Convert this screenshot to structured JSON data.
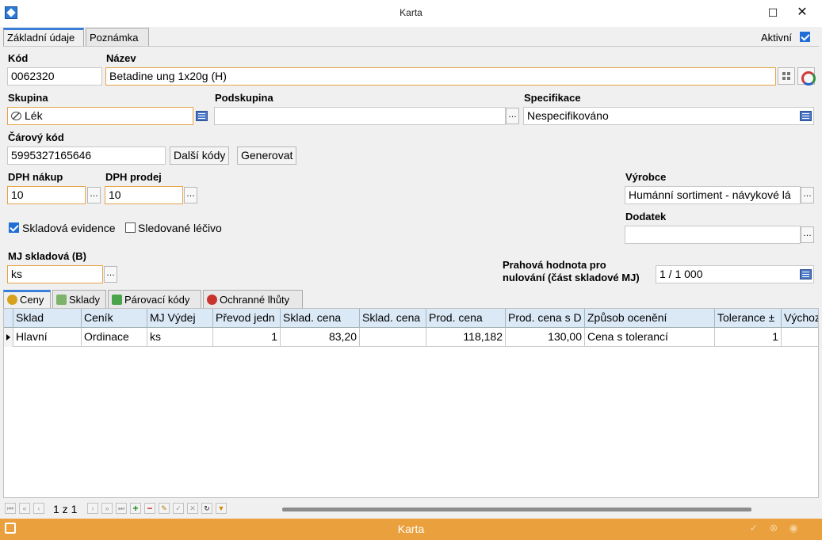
{
  "window": {
    "title": "Karta"
  },
  "tabs_top": [
    {
      "label": "Základní údaje",
      "active": true
    },
    {
      "label": "Poznámka",
      "active": false
    }
  ],
  "aktivni": {
    "label": "Aktivní",
    "checked": true
  },
  "fields": {
    "kod": {
      "label": "Kód",
      "value": "0062320"
    },
    "nazev": {
      "label": "Název",
      "value": "Betadine ung 1x20g (H)"
    },
    "skupina": {
      "label": "Skupina",
      "value": "Lék"
    },
    "podskupina": {
      "label": "Podskupina",
      "value": ""
    },
    "specifikace": {
      "label": "Specifikace",
      "value": "Nespecifikováno"
    },
    "carovy_kod": {
      "label": "Čárový kód",
      "value": "5995327165646"
    },
    "dph_nakup": {
      "label": "DPH nákup",
      "value": "10"
    },
    "dph_prodej": {
      "label": "DPH prodej",
      "value": "10"
    },
    "vyrobce": {
      "label": "Výrobce",
      "value": "Humánní sortiment - návykové lá"
    },
    "dodatek": {
      "label": "Dodatek",
      "value": ""
    },
    "mj_skladova": {
      "label": "MJ skladová (B)",
      "value": "ks"
    },
    "prahova": {
      "label_line1": "Prahová hodnota pro",
      "label_line2": "nulování (část skladové MJ)",
      "value": "1 / 1 000"
    }
  },
  "buttons": {
    "dalsi_kody": "Další kódy",
    "generovat": "Generovat"
  },
  "checkboxes": {
    "skladova_evidence": {
      "label": "Skladová evidence",
      "checked": true
    },
    "sledovane_lecivo": {
      "label": "Sledované léčivo",
      "checked": false
    }
  },
  "tabs_bottom": [
    {
      "label": "Ceny",
      "active": true
    },
    {
      "label": "Sklady",
      "active": false
    },
    {
      "label": "Párovací kódy",
      "active": false
    },
    {
      "label": "Ochranné lhůty",
      "active": false
    }
  ],
  "grid": {
    "columns": [
      "Sklad",
      "Ceník",
      "MJ Výdej",
      "Převod jedn",
      "Sklad. cena",
      "Sklad. cena",
      "Prod. cena",
      "Prod. cena s D",
      "Způsob ocenění",
      "Tolerance ±",
      "Výchoz"
    ],
    "rows": [
      [
        "Hlavní",
        "Ordinace",
        "ks",
        "1",
        "83,20",
        "",
        "118,182",
        "130,00",
        "Cena s tolerancí",
        "1",
        ""
      ]
    ]
  },
  "navigator": {
    "page_info": "1 z 1"
  },
  "statusbar": {
    "title": "Karta"
  }
}
